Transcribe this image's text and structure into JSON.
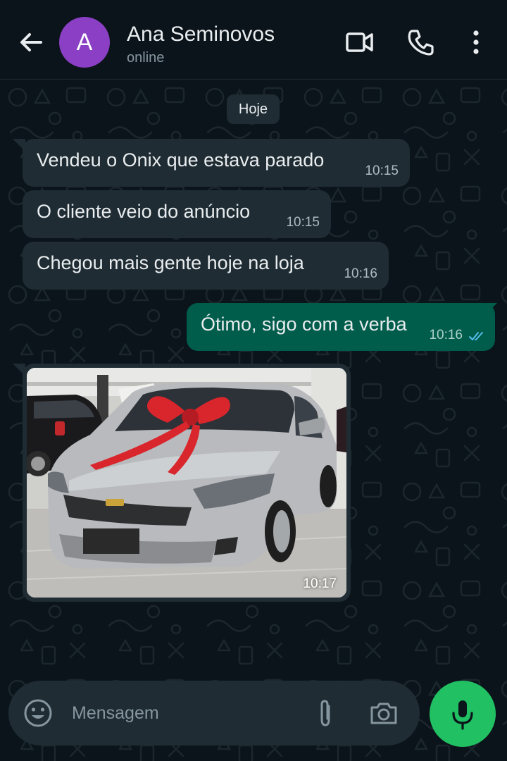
{
  "header": {
    "avatar_letter": "A",
    "contact_name": "Ana Seminovos",
    "status": "online"
  },
  "chat": {
    "date_chip": "Hoje",
    "messages": [
      {
        "direction": "incoming",
        "text": "Vendeu o Onix que estava parado",
        "time": "10:15"
      },
      {
        "direction": "incoming",
        "text": "O cliente veio do anúncio",
        "time": "10:15"
      },
      {
        "direction": "incoming",
        "text": "Chegou mais gente hoje na loja",
        "time": "10:16"
      },
      {
        "direction": "outgoing",
        "text": "Ótimo, sigo com a verba",
        "time": "10:16",
        "read": true
      },
      {
        "direction": "incoming",
        "type": "image",
        "time": "10:17"
      }
    ]
  },
  "input": {
    "placeholder": "Mensagem"
  },
  "icons": {
    "back": "arrow-left-icon",
    "video": "video-camera-icon",
    "call": "phone-icon",
    "menu": "more-vertical-icon",
    "emoji": "emoji-icon",
    "attach": "paperclip-icon",
    "camera": "camera-icon",
    "mic": "microphone-icon"
  },
  "colors": {
    "background": "#0b141a",
    "incoming_bubble": "#1f2c33",
    "outgoing_bubble": "#005c4b",
    "accent_green": "#21c063",
    "avatar": "#8a3fc4",
    "read_ticks": "#53bdeb"
  }
}
